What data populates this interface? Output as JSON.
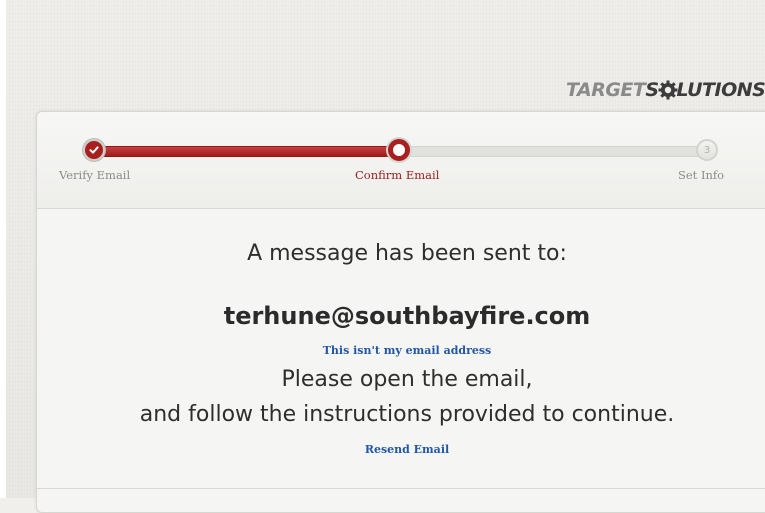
{
  "brand": {
    "logo_part_a": "TARGET",
    "logo_part_b": "S",
    "logo_part_c": "LUTIONS",
    "gear_icon": "gear-icon"
  },
  "progress": {
    "accent_color": "#a91f1f",
    "steps": [
      {
        "label": "Verify Email",
        "state": "done",
        "marker": "check-icon"
      },
      {
        "label": "Confirm Email",
        "state": "current",
        "marker": ""
      },
      {
        "label": "Set Info",
        "state": "future",
        "marker": "3"
      }
    ]
  },
  "content": {
    "sent_message": "A message has been sent to:",
    "email_address": "terhune@southbayfire.com",
    "not_my_email_link": "This isn't my email address",
    "instruction_line1": "Please open the email,",
    "instruction_line2": "and follow the instructions provided to continue.",
    "resend_link": "Resend Email",
    "link_color": "#2257a5"
  }
}
